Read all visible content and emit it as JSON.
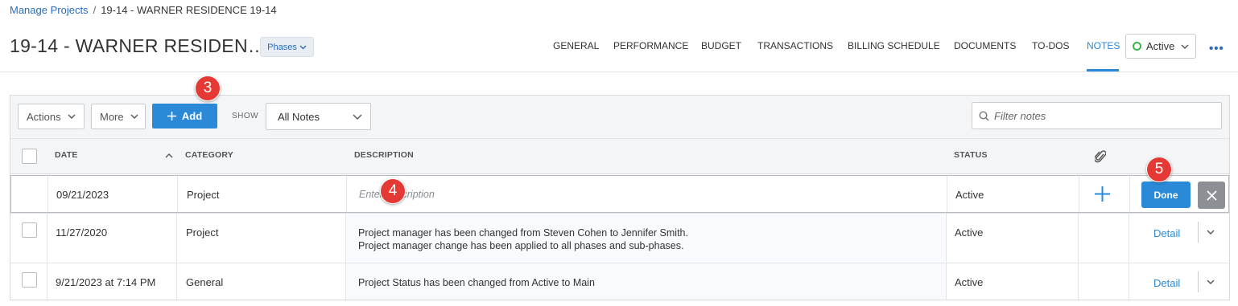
{
  "breadcrumb": {
    "parent": "Manage Projects",
    "separator": "/",
    "current": "19-14 - WARNER RESIDENCE 19-14"
  },
  "page_title": "19-14 - WARNER RESIDEN…",
  "phases_button": "Phases",
  "nav_tabs": [
    "GENERAL",
    "PERFORMANCE",
    "BUDGET",
    "TRANSACTIONS",
    "BILLING SCHEDULE",
    "DOCUMENTS",
    "TO-DOS",
    "NOTES"
  ],
  "active_tab": "NOTES",
  "project_status": "Active",
  "toolbar": {
    "actions_label": "Actions",
    "more_label": "More",
    "add_label": "Add",
    "show_label": "SHOW",
    "show_value": "All Notes",
    "filter_placeholder": "Filter notes"
  },
  "columns": {
    "date": "DATE",
    "category": "CATEGORY",
    "description": "DESCRIPTION",
    "status": "STATUS"
  },
  "edit_row": {
    "date": "09/21/2023",
    "category": "Project",
    "description_placeholder": "Enter description",
    "status": "Active",
    "done_label": "Done"
  },
  "notes": [
    {
      "date": "11/27/2020",
      "category": "Project",
      "description_line1": "Project manager has been changed from Steven Cohen to Jennifer Smith.",
      "description_line2": "Project manager change has been applied to all phases and sub-phases.",
      "status": "Active",
      "action": "Detail"
    },
    {
      "date": "9/21/2023 at 7:14 PM",
      "category": "General",
      "description_line1": "Project Status has been changed from Active to Main",
      "status": "Active",
      "action": "Detail"
    }
  ],
  "callouts": {
    "add": "3",
    "description": "4",
    "done": "5"
  },
  "colors": {
    "accent": "#2a8ad8",
    "link": "#2a6db5",
    "callout": "#e53935",
    "active_status": "#3bb54a"
  }
}
